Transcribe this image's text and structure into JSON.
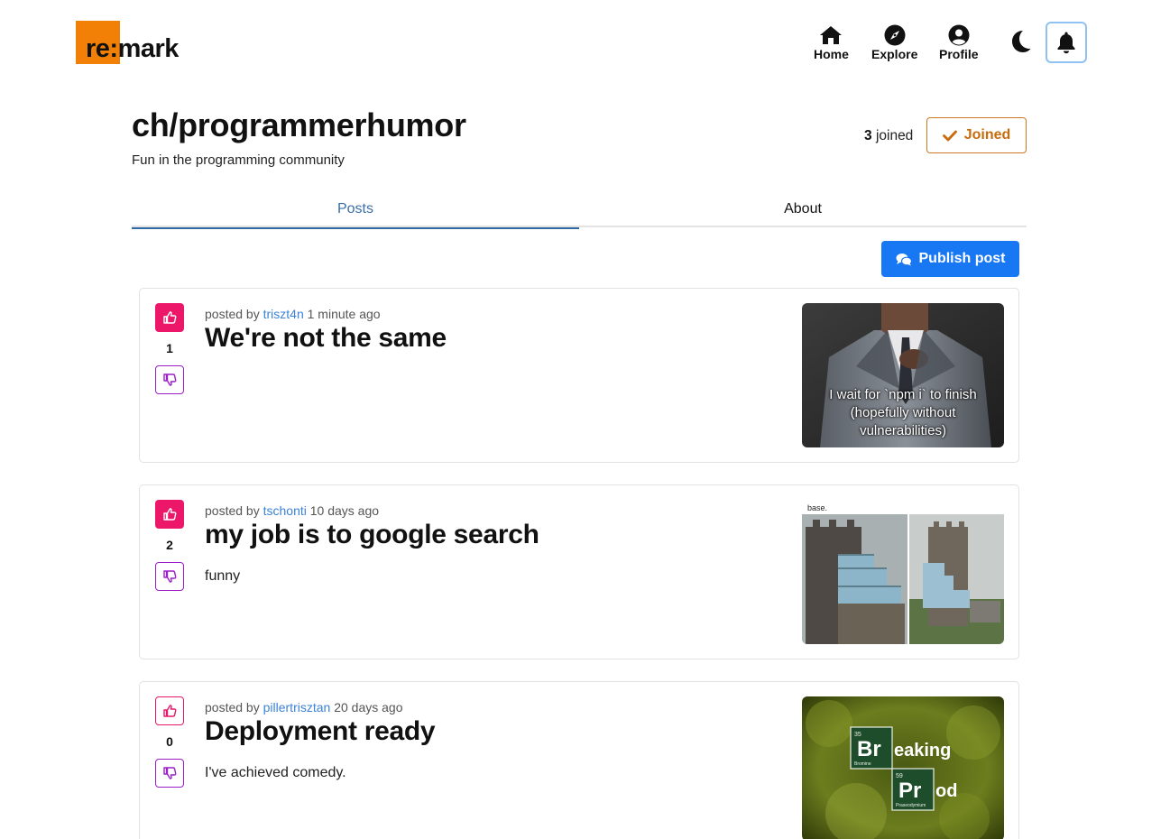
{
  "header": {
    "logo_text": "re:mark",
    "nav": [
      {
        "label": "Home",
        "icon": "home-icon"
      },
      {
        "label": "Explore",
        "icon": "compass-icon"
      },
      {
        "label": "Profile",
        "icon": "user-circle-icon"
      }
    ],
    "theme_toggle_icon": "moon-icon",
    "notifications_icon": "bell-icon"
  },
  "community": {
    "title": "ch/programmerhumor",
    "description": "Fun in the programming community",
    "joined_count": "3",
    "joined_suffix": "joined",
    "joined_button": "Joined"
  },
  "tabs": [
    {
      "label": "Posts",
      "active": true
    },
    {
      "label": "About",
      "active": false
    }
  ],
  "publish_button": "Publish post",
  "posts": [
    {
      "posted_by_prefix": "posted by",
      "author": "triszt4n",
      "time": "1 minute ago",
      "title": "We're not the same",
      "body": "",
      "votes": "1",
      "upvoted": true,
      "image_caption": "I wait for `npm i` to finish (hopefully without vulnerabilities)"
    },
    {
      "posted_by_prefix": "posted by",
      "author": "tschonti",
      "time": "10 days ago",
      "title": "my job is to google search",
      "body": "funny",
      "votes": "2",
      "upvoted": true,
      "image_caption": "base."
    },
    {
      "posted_by_prefix": "posted by",
      "author": "pillertrisztan",
      "time": "20 days ago",
      "title": "Deployment ready",
      "body": "I've achieved comedy.",
      "votes": "0",
      "upvoted": false,
      "image_tiles": [
        {
          "number": "35",
          "symbol": "Br",
          "name": "Bromine",
          "rest": "eaking"
        },
        {
          "number": "59",
          "symbol": "Pr",
          "name": "Praseodymium",
          "rest": "od"
        }
      ]
    }
  ],
  "colors": {
    "brand_orange": "#f27f06",
    "primary_blue": "#1877f2",
    "upvote_pink": "#ec1768",
    "downvote_purple": "#9b1ec8",
    "joined_orange": "#c86b0d"
  }
}
